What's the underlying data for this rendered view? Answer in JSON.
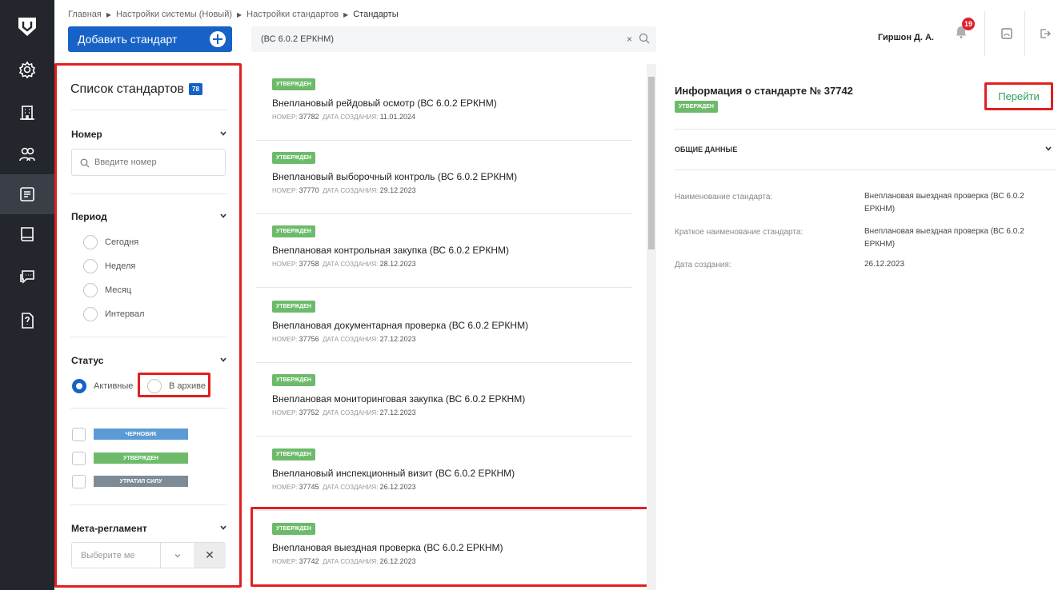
{
  "breadcrumb": [
    "Главная",
    "Настройки системы (Новый)",
    "Настройки стандартов",
    "Стандарты"
  ],
  "toolbar": {
    "add_label": "Добавить стандарт",
    "search_value": "(ВС 6.0.2 ЕРКНМ)",
    "clear_label": "×",
    "user_name": "Гиршон Д. А.",
    "notifications": "19"
  },
  "filters": {
    "title": "Список стандартов",
    "count": "78",
    "number_label": "Номер",
    "number_placeholder": "Введите номер",
    "period_label": "Период",
    "period_options": [
      "Сегодня",
      "Неделя",
      "Месяц",
      "Интервал"
    ],
    "status_label": "Статус",
    "status_active": "Активные",
    "status_archive": "В архиве",
    "tags": [
      {
        "label": "ЧЕРНОВИК",
        "color": "#5b9bd5"
      },
      {
        "label": "УТВЕРЖДЕН",
        "color": "#6dbb6a"
      },
      {
        "label": "УТРАТИЛ СИЛУ",
        "color": "#7d8b96"
      }
    ],
    "meta_label": "Мета-регламент",
    "meta_placeholder": "Выберите ме",
    "meta_clear": "✕"
  },
  "list": {
    "number_prefix": "НОМЕР:",
    "date_prefix": "ДАТА СОЗДАНИЯ:",
    "items": [
      {
        "status": "УТВЕРЖДЕН",
        "name": "Внеплановый рейдовый осмотр (ВС 6.0.2 ЕРКНМ)",
        "number": "37782",
        "date": "11.01.2024"
      },
      {
        "status": "УТВЕРЖДЕН",
        "name": "Внеплановый выборочный контроль (ВС 6.0.2 ЕРКНМ)",
        "number": "37770",
        "date": "29.12.2023"
      },
      {
        "status": "УТВЕРЖДЕН",
        "name": "Внеплановая контрольная закупка (ВС 6.0.2 ЕРКНМ)",
        "number": "37758",
        "date": "28.12.2023"
      },
      {
        "status": "УТВЕРЖДЕН",
        "name": "Внеплановая документарная проверка (ВС 6.0.2 ЕРКНМ)",
        "number": "37756",
        "date": "27.12.2023"
      },
      {
        "status": "УТВЕРЖДЕН",
        "name": "Внеплановая мониторинговая закупка (ВС 6.0.2 ЕРКНМ)",
        "number": "37752",
        "date": "27.12.2023"
      },
      {
        "status": "УТВЕРЖДЕН",
        "name": "Внеплановый инспекционный визит (ВС 6.0.2 ЕРКНМ)",
        "number": "37745",
        "date": "26.12.2023"
      },
      {
        "status": "УТВЕРЖДЕН",
        "name": "Внеплановая выездная проверка (ВС 6.0.2 ЕРКНМ)",
        "number": "37742",
        "date": "26.12.2023"
      }
    ]
  },
  "info": {
    "title": "Информация о стандарте № 37742",
    "status": "УТВЕРЖДЕН",
    "goto_label": "Перейти",
    "section": "ОБЩИЕ ДАННЫЕ",
    "rows": [
      {
        "label": "Наименование стандарта:",
        "value": "Внеплановая выездная проверка (ВС 6.0.2 ЕРКНМ)"
      },
      {
        "label": "Краткое наименование стандарта:",
        "value": "Внеплановая выездная проверка (ВС 6.0.2 ЕРКНМ)"
      },
      {
        "label": "Дата создания:",
        "value": "26.12.2023"
      }
    ]
  }
}
